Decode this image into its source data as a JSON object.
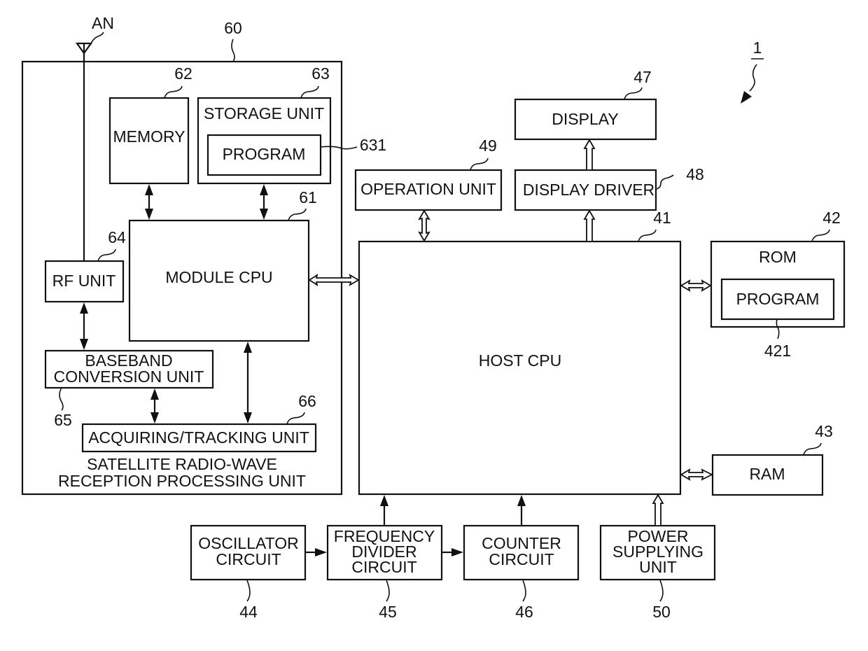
{
  "figure": {
    "ref": "1",
    "antenna": {
      "label": "AN"
    },
    "blocks": {
      "satellite_unit": {
        "ref": "60",
        "label_line1": "SATELLITE RADIO-WAVE",
        "label_line2": "RECEPTION PROCESSING UNIT"
      },
      "module_cpu": {
        "ref": "61",
        "label": "MODULE CPU"
      },
      "memory": {
        "ref": "62",
        "label": "MEMORY"
      },
      "storage_unit": {
        "ref": "63",
        "label": "STORAGE UNIT"
      },
      "storage_program": {
        "ref": "631",
        "label": "PROGRAM"
      },
      "rf_unit": {
        "ref": "64",
        "label": "RF UNIT"
      },
      "baseband": {
        "ref": "65",
        "label_line1": "BASEBAND",
        "label_line2": "CONVERSION UNIT"
      },
      "acquiring": {
        "ref": "66",
        "label": "ACQUIRING/TRACKING UNIT"
      },
      "host_cpu": {
        "ref": "41",
        "label": "HOST CPU"
      },
      "rom": {
        "ref": "42",
        "label": "ROM"
      },
      "rom_program": {
        "ref": "421",
        "label": "PROGRAM"
      },
      "ram": {
        "ref": "43",
        "label": "RAM"
      },
      "oscillator": {
        "ref": "44",
        "label_line1": "OSCILLATOR",
        "label_line2": "CIRCUIT"
      },
      "freq_divider": {
        "ref": "45",
        "label_line1": "FREQUENCY",
        "label_line2": "DIVIDER",
        "label_line3": "CIRCUIT"
      },
      "counter": {
        "ref": "46",
        "label_line1": "COUNTER",
        "label_line2": "CIRCUIT"
      },
      "display": {
        "ref": "47",
        "label": "DISPLAY"
      },
      "display_driver": {
        "ref": "48",
        "label": "DISPLAY DRIVER"
      },
      "operation_unit": {
        "ref": "49",
        "label": "OPERATION UNIT"
      },
      "power": {
        "ref": "50",
        "label_line1": "POWER",
        "label_line2": "SUPPLYING",
        "label_line3": "UNIT"
      }
    }
  }
}
